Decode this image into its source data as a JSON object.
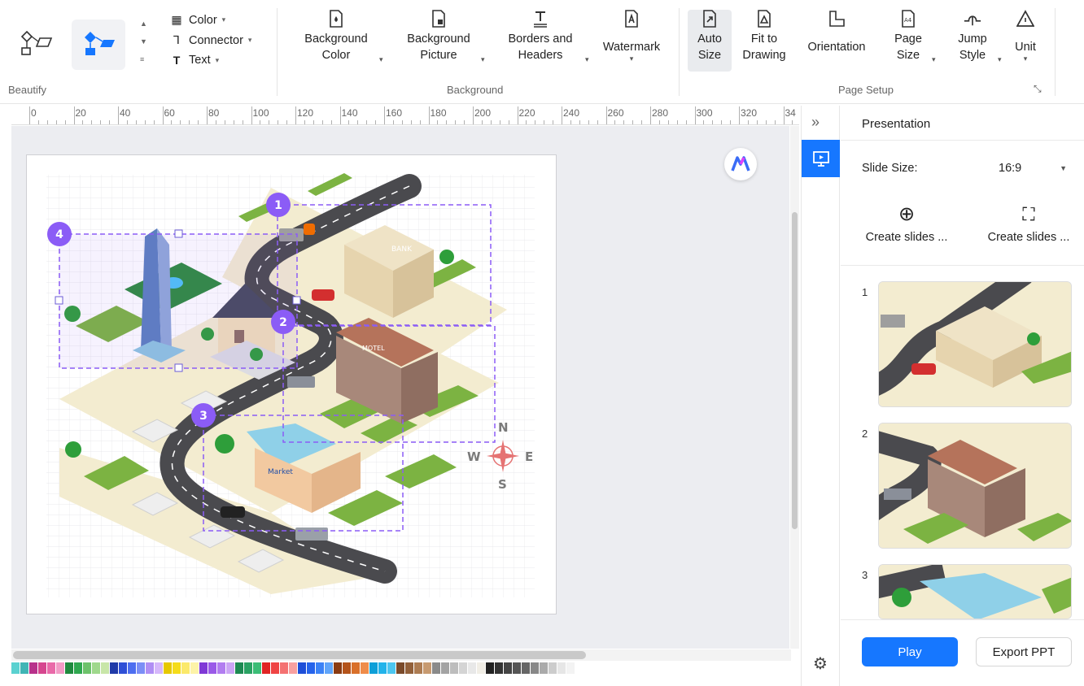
{
  "ribbon": {
    "beautify_label": "Beautify",
    "color_label": "Color",
    "connector_label": "Connector",
    "text_label": "Text",
    "background_group": "Background",
    "page_setup_group": "Page Setup",
    "background_color": "Background\nColor",
    "background_picture": "Background\nPicture",
    "borders_headers": "Borders and\nHeaders",
    "watermark": "Watermark",
    "auto_size": "Auto\nSize",
    "fit_to_drawing": "Fit to\nDrawing",
    "orientation": "Orientation",
    "page_size": "Page\nSize",
    "jump_style": "Jump\nStyle",
    "unit": "Unit"
  },
  "ruler": {
    "marks": [
      "0",
      "20",
      "40",
      "60",
      "80",
      "100",
      "120",
      "140",
      "160",
      "180",
      "200",
      "220",
      "240",
      "260",
      "280",
      "300",
      "320",
      "34"
    ]
  },
  "canvas": {
    "markers": [
      "1",
      "2",
      "3",
      "4"
    ],
    "compass": {
      "n": "N",
      "s": "S",
      "e": "E",
      "w": "W"
    },
    "signs": {
      "bank": "BANK",
      "motel": "MOTEL",
      "market": "Market"
    }
  },
  "panel": {
    "title": "Presentation",
    "slide_size_label": "Slide Size:",
    "slide_size_value": "16:9",
    "create_slides_1": "Create slides ...",
    "create_slides_2": "Create slides ...",
    "slides": [
      "1",
      "2",
      "3"
    ],
    "play": "Play",
    "export_ppt": "Export PPT"
  },
  "colors": {
    "accent": "#1677ff",
    "marker_purple": "#8b5cf6"
  },
  "palette": [
    "#5ad1d0",
    "#40b5b5",
    "#b8318b",
    "#d6468f",
    "#e96aa9",
    "#f29bc6",
    "#1e8a3e",
    "#2fa84f",
    "#6dc26b",
    "#9fd88c",
    "#c8e6a8",
    "#1f3aa8",
    "#2f4fd6",
    "#4d6ef0",
    "#7b8ef6",
    "#b08ef4",
    "#d6b7fb",
    "#e6c800",
    "#f5dc1a",
    "#fbe96b",
    "#fdf3a8",
    "#7f39d6",
    "#9a5ae8",
    "#b27df0",
    "#cca5f5",
    "#1d8a52",
    "#2aa263",
    "#3bbd76",
    "#e02424",
    "#ef4444",
    "#f47171",
    "#f8a0a0",
    "#1d4ed8",
    "#2563eb",
    "#3b82f6",
    "#60a5fa",
    "#8a3b12",
    "#b4531a",
    "#d9702a",
    "#ef8c4a",
    "#0e9fd8",
    "#22b3ea",
    "#4cc6f0",
    "#7a4a2a",
    "#92603a",
    "#ad7c52",
    "#c79a70",
    "#8a8a8a",
    "#a3a3a3",
    "#bdbdbd",
    "#d4d4d4",
    "#e8e8e8",
    "#f1eee6",
    "#222222",
    "#333333",
    "#444444",
    "#555555",
    "#666666",
    "#888888",
    "#aaaaaa",
    "#cccccc",
    "#e6e6e6",
    "#f3f3f3"
  ]
}
